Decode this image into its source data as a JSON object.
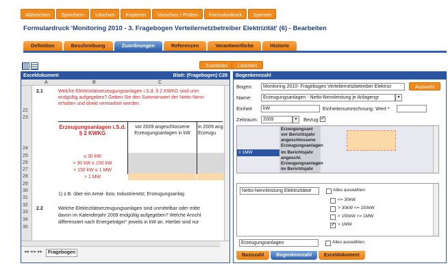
{
  "toolbar": [
    "Abbrechen",
    "Speichern",
    "Löschen",
    "Kopieren",
    "Vorschau / Prüfen",
    "Formulardruck",
    "Sperren"
  ],
  "page_title": "Formulardruck 'Monitoring 2010 - 3. Fragebogen Verteilernetzbetreiber Elektrizität' (6) - Bearbeiten",
  "tabs": [
    "Definition",
    "Beschreibung",
    "Zuordnungen",
    "Referenzen",
    "Verantwortliche",
    "Historie"
  ],
  "actions": {
    "zuordnen": "Zuordnen",
    "loeschen": "Löschen"
  },
  "left": {
    "header_left": "Exceldokument",
    "header_right": "Blatt: (Fragebogen) C28",
    "cols": [
      "A",
      "B",
      "C"
    ],
    "rows": [
      "22",
      "23",
      "24",
      "25",
      "26",
      "27",
      "28",
      "29",
      "30",
      "31",
      "32",
      "33",
      "34",
      "35"
    ],
    "c21": "2.1",
    "c21text": "Welche Elektrizitätserzeugungsanlagen i.S.d. § 2 KWKG sind unm",
    "c21text2": "endgültig aufgegeben? Geben Sie den Summenwert der Netto-Nenn",
    "c21text3": "erhalten und direkt vermarktet werden.",
    "tblhead": "Erzeugungsanlagen i.S.d.",
    "tblhead2": "§ 2 KWKG",
    "tblc1": "vor 2009 angeschlossene",
    "tblc1b": "Erzeugungsanlagen in kW",
    "tblc2": "in 2009 ang",
    "tblc2b": "Erzeugu",
    "r25": "≤ 30 kW",
    "r26": "> 30 kW ≤ 150 kW",
    "r27": "> 150 kW ≤ 1 MW",
    "r28": "> 1 MW",
    "note": "1) z.B. über ein Areal- bzw. Industrienetz; Erzeugungsanlag",
    "c22": "2.2",
    "c22text": "Welche Elektrizitätserzeugungsanlagen sind unmittelbar oder mitte",
    "c22text2": "davon im Kalenderjahr 2009 endgültig aufgegeben? Welche Anschl",
    "c22text3": "differenziert nach Energieträger\" jeweils in kW an. Hierbei sind nur",
    "sheet_tab": "Fragebogen"
  },
  "right": {
    "header": "Bogenkennzahl",
    "bogen_label": "Bogen:",
    "bogen_value": "Monitoring 2010- Fragebogen Verteilernetzbetreiber Elektrizi",
    "auswahl": "Auswahl",
    "name_label": "Name:",
    "name_value": "Erzeugungsanlagen - Netto-Nennleistung je Anlagengr",
    "einheit_label": "Einheit",
    "einheit_value": "kW",
    "umrechnung_label": "Einheitenumrechnung: Wert *",
    "zeitraum_label": "Zeitraum:",
    "zeitraum_value": "2009",
    "bezug_label": "Bezug:",
    "grid_row": "> 1MW",
    "grid_cells": [
      "Erzeugungsanl",
      "vor Berichtsjahr",
      "angeschlossene",
      "Erzeugungsanlagen",
      "im Berichtsjahr",
      "angeschl.",
      "Erzeugungsanlagen",
      "im Berichtsjahr",
      "endgültig aufgeaeb"
    ],
    "dim1": "Netto-Nennleistung Elektrizitätse",
    "alle1": "Alles auswählen",
    "opts": [
      "<= 30kW",
      "> 30kW <= 150kW",
      "> 150kW <= 1MW",
      "> 1MW"
    ],
    "dim2": "Erzeugungsanlagen",
    "alle2": "Alles auswählen",
    "bottom_tabs": [
      "Basiszahl",
      "Bogenkennzahl",
      "Exceldokument"
    ]
  }
}
